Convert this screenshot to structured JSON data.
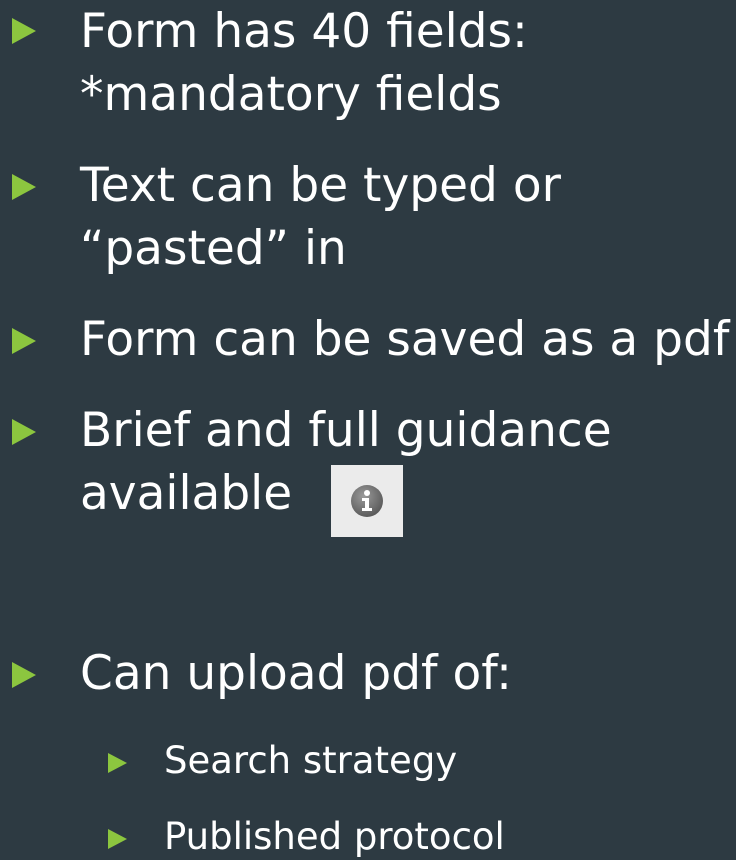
{
  "bullets": [
    {
      "lines": [
        "Form has 40 fields:",
        "*mandatory fields"
      ]
    },
    {
      "lines": [
        "Text can be typed or",
        "“pasted” in"
      ]
    },
    {
      "lines": [
        "Form can be saved as a pdf"
      ]
    },
    {
      "lines": [
        "Brief and full guidance",
        "available"
      ]
    },
    {
      "lines": [
        "Can upload pdf of:"
      ]
    }
  ],
  "subbullets": [
    {
      "label": "Search strategy"
    },
    {
      "label": "Published protocol"
    }
  ],
  "icons": {
    "info": "info-icon"
  },
  "colors": {
    "background": "#2d3a42",
    "bullet": "#8cc63f",
    "text": "#ffffff"
  }
}
